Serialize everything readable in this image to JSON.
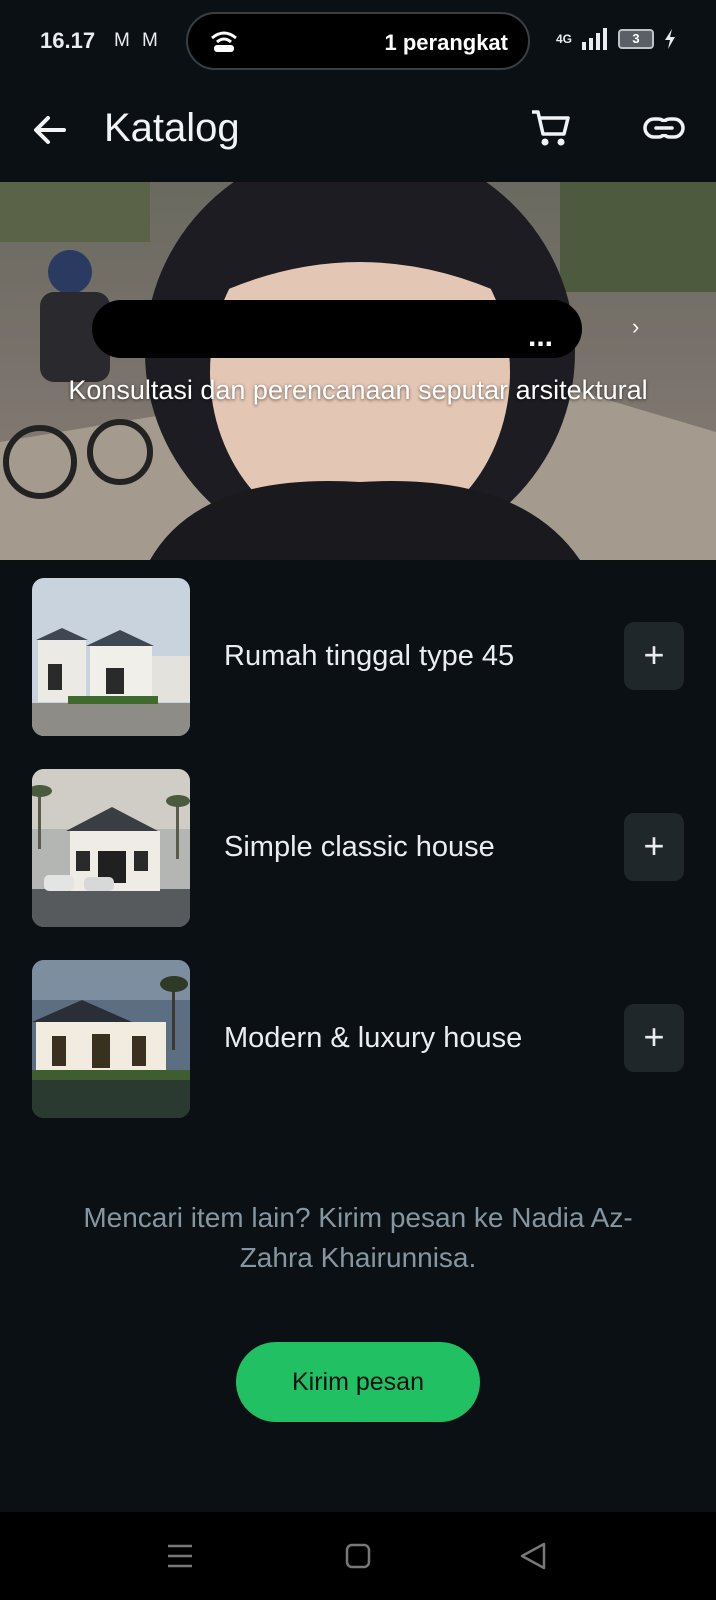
{
  "status_bar": {
    "time": "16.17",
    "mail_icons": [
      "M",
      "M"
    ],
    "pill_text": "1 perangkat",
    "network": "4G",
    "battery": "3"
  },
  "app_bar": {
    "title": "Katalog",
    "icons": [
      "back-arrow-icon",
      "cart-icon",
      "link-icon"
    ]
  },
  "cover": {
    "ellipsis": "...",
    "description": "Konsultasi dan perencanaan seputar arsitektural"
  },
  "products": [
    {
      "name": "Rumah tinggal type 45"
    },
    {
      "name": "Simple classic house"
    },
    {
      "name": "Modern & luxury house"
    }
  ],
  "add_label": "+",
  "footer_text": "Mencari item lain? Kirim pesan ke Nadia Az-Zahra Khairunnisa.",
  "send_button": "Kirim pesan",
  "colors": {
    "background": "#0b1014",
    "accent_green": "#21c063",
    "secondary_text": "#8696a0"
  }
}
